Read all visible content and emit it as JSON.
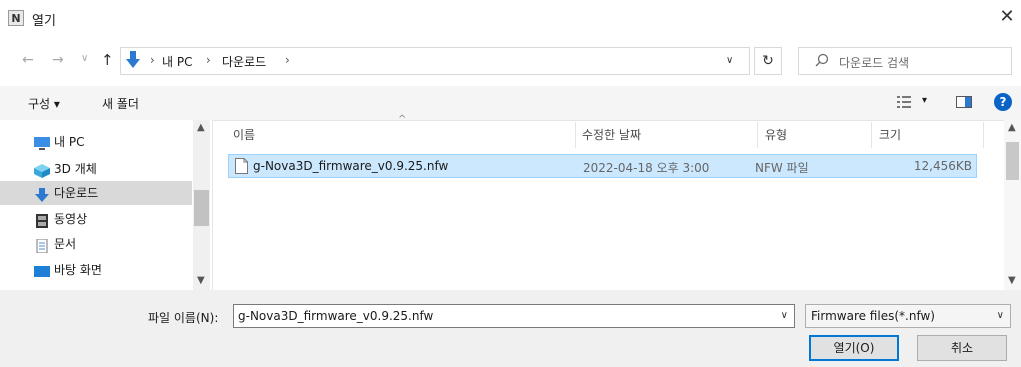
{
  "window": {
    "app_icon_letter": "N",
    "title": "열기",
    "close": "✕"
  },
  "nav": {
    "back": "←",
    "forward": "→",
    "recent": "∨",
    "up": "↑"
  },
  "address": {
    "crumbs": [
      "내 PC",
      "다운로드"
    ],
    "sep": "›",
    "dropdown": "∨",
    "refresh": "↻"
  },
  "search": {
    "placeholder": "다운로드 검색"
  },
  "toolbar": {
    "organize": "구성 ▾",
    "new_folder": "새 폴더",
    "view_arrow": "▾",
    "help": "?"
  },
  "sidebar": {
    "items": [
      {
        "label": "내 PC"
      },
      {
        "label": "3D 개체"
      },
      {
        "label": "다운로드"
      },
      {
        "label": "동영상"
      },
      {
        "label": "문서"
      },
      {
        "label": "바탕 화면"
      }
    ]
  },
  "columns": {
    "name": "이름",
    "date": "수정한 날짜",
    "type": "유형",
    "size": "크기",
    "sort_arrow": "^"
  },
  "files": [
    {
      "name": "g-Nova3D_firmware_v0.9.25.nfw",
      "date": "2022-04-18 오후 3:00",
      "type": "NFW 파일",
      "size": "12,456KB"
    }
  ],
  "bottom": {
    "filename_label": "파일 이름(N):",
    "filename_value": "g-Nova3D_firmware_v0.9.25.nfw",
    "filetype": "Firmware files(*.nfw)",
    "dropdown": "∨",
    "open": "열기(O)",
    "cancel": "취소"
  },
  "colors": {
    "accent": "#0078d7",
    "selection": "#cce8ff",
    "selection_border": "#99d1ff"
  }
}
